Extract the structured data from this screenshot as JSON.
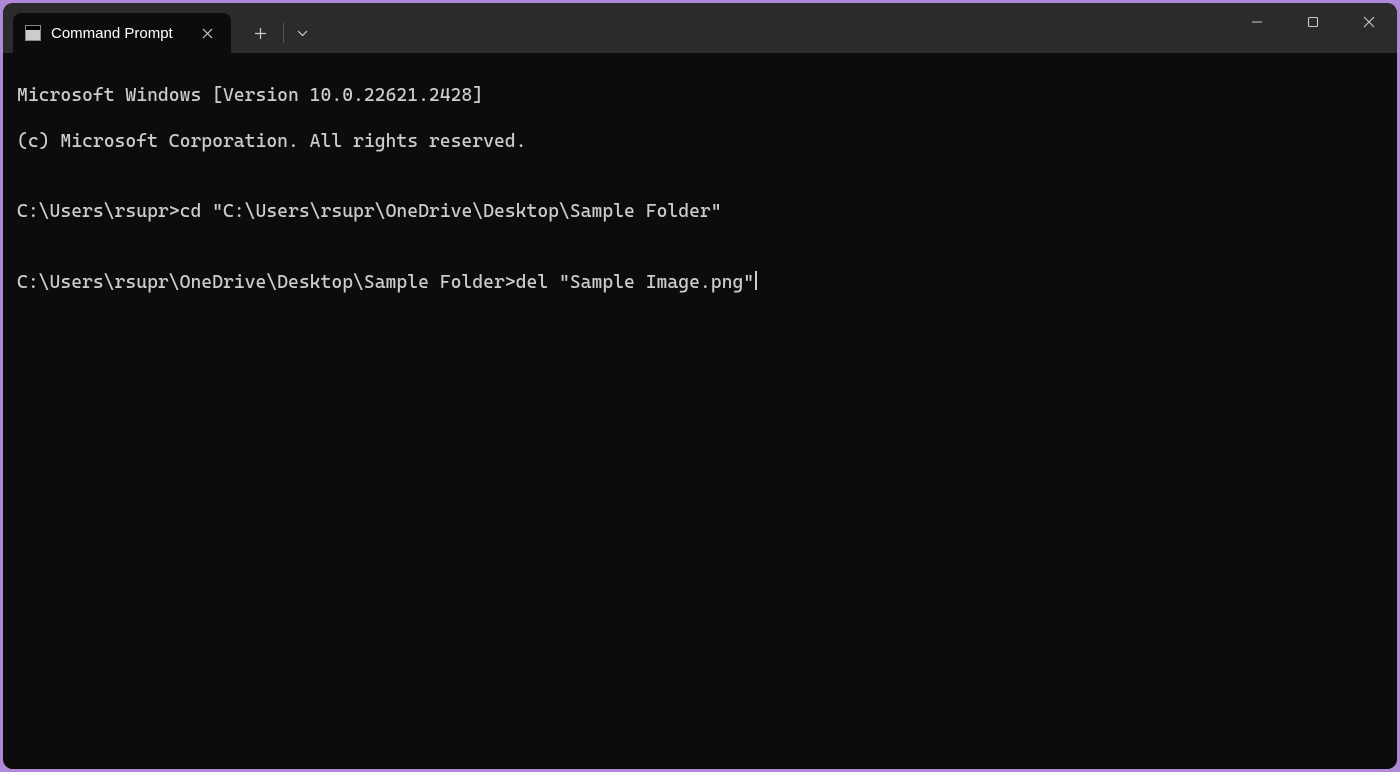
{
  "tab": {
    "title": "Command Prompt"
  },
  "terminal": {
    "line1": "Microsoft Windows [Version 10.0.22621.2428]",
    "line2": "(c) Microsoft Corporation. All rights reserved.",
    "blank1": "",
    "prompt1": "C:\\Users\\rsupr>",
    "command1": "cd \"C:\\Users\\rsupr\\OneDrive\\Desktop\\Sample Folder\"",
    "blank2": "",
    "prompt2": "C:\\Users\\rsupr\\OneDrive\\Desktop\\Sample Folder>",
    "command2": "del \"Sample Image.png\""
  }
}
